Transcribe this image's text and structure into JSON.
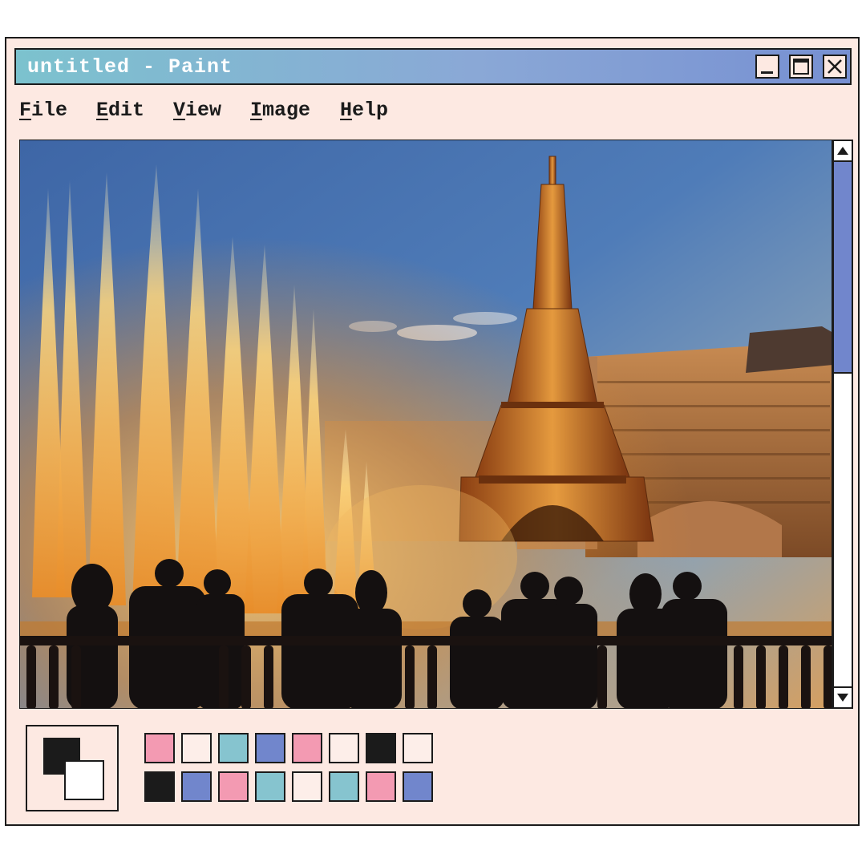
{
  "window": {
    "title": "untitled - Paint",
    "buttons": [
      {
        "name": "minimize-button",
        "icon": "minimize-icon"
      },
      {
        "name": "maximize-button",
        "icon": "maximize-icon"
      },
      {
        "name": "close-button",
        "icon": "close-icon"
      }
    ]
  },
  "menu": [
    {
      "key": "F",
      "rest": "ile"
    },
    {
      "key": "E",
      "rest": "dit"
    },
    {
      "key": "V",
      "rest": "iew"
    },
    {
      "key": "I",
      "rest": "mage"
    },
    {
      "key": "H",
      "rest": "elp"
    }
  ],
  "canvas": {
    "scene": "paris-las-vegas-eiffel-tower-fountains-photo"
  },
  "scrollbar": {
    "position_fraction": 0.0,
    "visible_fraction": 0.39,
    "up_icon": "triangle-up-icon",
    "down_icon": "triangle-down-icon"
  },
  "colors": {
    "foreground": "#1b1b1b",
    "background": "#ffffff",
    "titlebar_start": "#7cc2ce",
    "titlebar_end": "#7790d2",
    "window_bg": "#fde9e2"
  },
  "palette": {
    "row1": [
      "#f39ab2",
      "#fdeee9",
      "#86c4cf",
      "#7186cc",
      "#f39ab2",
      "#fdeee9",
      "#1b1b1b",
      "#fdeee9"
    ],
    "row2": [
      "#1b1b1b",
      "#7186cc",
      "#f39ab2",
      "#86c4cf",
      "#fdeee9",
      "#86c4cf",
      "#f39ab2",
      "#7186cc"
    ]
  }
}
